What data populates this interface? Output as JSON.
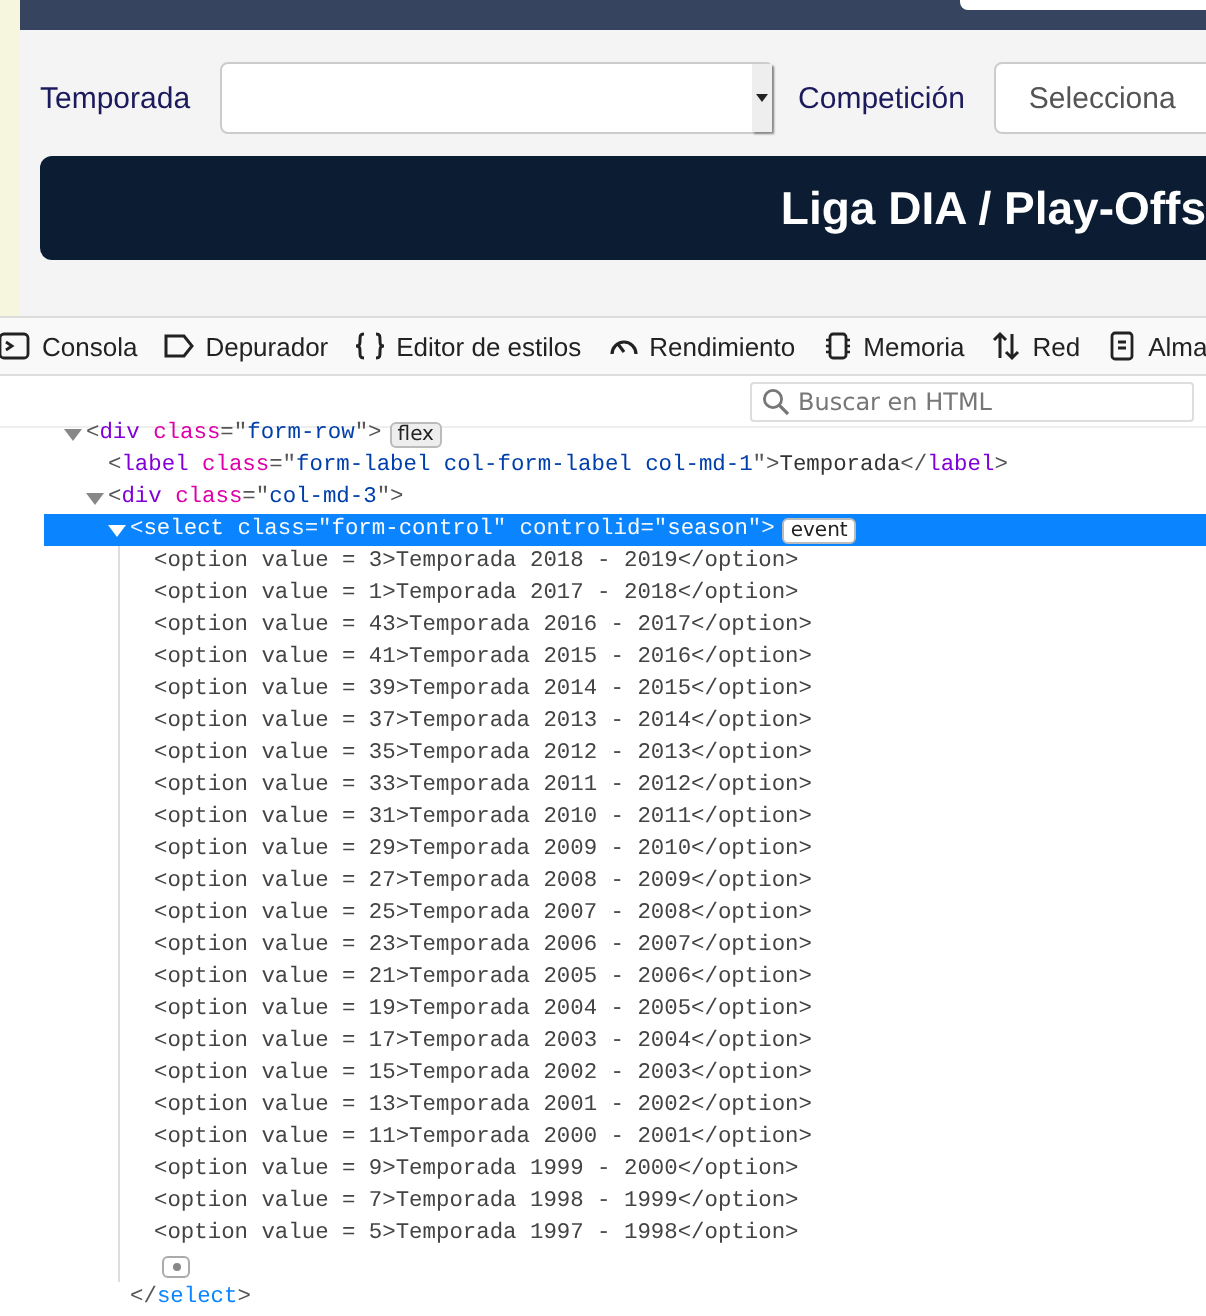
{
  "page": {
    "form": [
      {
        "label": "Temporada"
      },
      {
        "label": "Competición",
        "placeholder": "Selecciona"
      }
    ],
    "banner": "Liga DIA / Play-Offs"
  },
  "devtools": {
    "tabs": [
      {
        "kind": "console",
        "label": "Consola",
        "selected": false
      },
      {
        "kind": "debugger",
        "label": "Depurador",
        "selected": false
      },
      {
        "kind": "style",
        "label": "Editor de estilos",
        "selected": false
      },
      {
        "kind": "performance",
        "label": "Rendimiento",
        "selected": false
      },
      {
        "kind": "memory",
        "label": "Memoria",
        "selected": false
      },
      {
        "kind": "network",
        "label": "Red",
        "selected": false
      },
      {
        "kind": "storage",
        "label": "Alma",
        "selected": false
      }
    ],
    "search": {
      "placeholder": "Buscar en HTML"
    },
    "tree": [
      {
        "parts": [
          {
            "kind": "punct",
            "text": "<"
          },
          {
            "kind": "tag",
            "text": "div"
          },
          {
            "kind": "attr",
            "text": " class"
          },
          {
            "kind": "punct",
            "text": "=\""
          },
          {
            "kind": "value",
            "text": "form-row"
          },
          {
            "kind": "punct",
            "text": "\">"
          }
        ],
        "badge": "flex",
        "expanded": true,
        "selected": false,
        "children": [
          {
            "parts": [
              {
                "kind": "punct",
                "text": "<"
              },
              {
                "kind": "tag",
                "text": "label"
              },
              {
                "kind": "attr",
                "text": " class"
              },
              {
                "kind": "punct",
                "text": "=\""
              },
              {
                "kind": "value",
                "text": "form-label col-form-label col-md-1"
              },
              {
                "kind": "punct",
                "text": "\">"
              },
              {
                "kind": "text",
                "text": "Temporada"
              },
              {
                "kind": "punct",
                "text": "</"
              },
              {
                "kind": "tag",
                "text": "label"
              },
              {
                "kind": "punct",
                "text": ">"
              }
            ],
            "selected": false
          },
          {
            "parts": [
              {
                "kind": "punct",
                "text": "<"
              },
              {
                "kind": "tag",
                "text": "div"
              },
              {
                "kind": "attr",
                "text": " class"
              },
              {
                "kind": "punct",
                "text": "=\""
              },
              {
                "kind": "value",
                "text": "col-md-3"
              },
              {
                "kind": "punct",
                "text": "\">"
              }
            ],
            "expanded": true,
            "selected": false,
            "children": [
              {
                "parts": [
                  {
                    "kind": "punct",
                    "text": "<"
                  },
                  {
                    "kind": "tag",
                    "text": "select"
                  },
                  {
                    "kind": "attr",
                    "text": " class"
                  },
                  {
                    "kind": "punct",
                    "text": "=\""
                  },
                  {
                    "kind": "value",
                    "text": "form-control"
                  },
                  {
                    "kind": "punct",
                    "text": "\""
                  },
                  {
                    "kind": "attr",
                    "text": " controlid"
                  },
                  {
                    "kind": "punct",
                    "text": "=\""
                  },
                  {
                    "kind": "value",
                    "text": "season"
                  },
                  {
                    "kind": "punct",
                    "text": "\">"
                  }
                ],
                "badge": "event",
                "expanded": true,
                "selected": true,
                "whitespace": true,
                "closing": [
                  {
                    "kind": "punct",
                    "text": "</"
                  },
                  {
                    "kind": "closetag",
                    "text": "select"
                  },
                  {
                    "kind": "punct",
                    "text": ">"
                  }
                ],
                "lines": [
                  "<option value = 3>Temporada 2018 - 2019</option>",
                  "<option value = 1>Temporada 2017 - 2018</option>",
                  "<option value = 43>Temporada 2016 - 2017</option>",
                  "<option value = 41>Temporada 2015 - 2016</option>",
                  "<option value = 39>Temporada 2014 - 2015</option>",
                  "<option value = 37>Temporada 2013 - 2014</option>",
                  "<option value = 35>Temporada 2012 - 2013</option>",
                  "<option value = 33>Temporada 2011 - 2012</option>",
                  "<option value = 31>Temporada 2010 - 2011</option>",
                  "<option value = 29>Temporada 2009 - 2010</option>",
                  "<option value = 27>Temporada 2008 - 2009</option>",
                  "<option value = 25>Temporada 2007 - 2008</option>",
                  "<option value = 23>Temporada 2006 - 2007</option>",
                  "<option value = 21>Temporada 2005 - 2006</option>",
                  "<option value = 19>Temporada 2004 - 2005</option>",
                  "<option value = 17>Temporada 2003 - 2004</option>",
                  "<option value = 15>Temporada 2002 - 2003</option>",
                  "<option value = 13>Temporada 2001 - 2002</option>",
                  "<option value = 11>Temporada 2000 - 2001</option>",
                  "<option value = 9>Temporada 1999 - 2000</option>",
                  "<option value = 7>Temporada 1998 - 1999</option>",
                  "<option value = 5>Temporada 1997 - 1998</option>"
                ]
              }
            ]
          }
        ]
      }
    ]
  }
}
